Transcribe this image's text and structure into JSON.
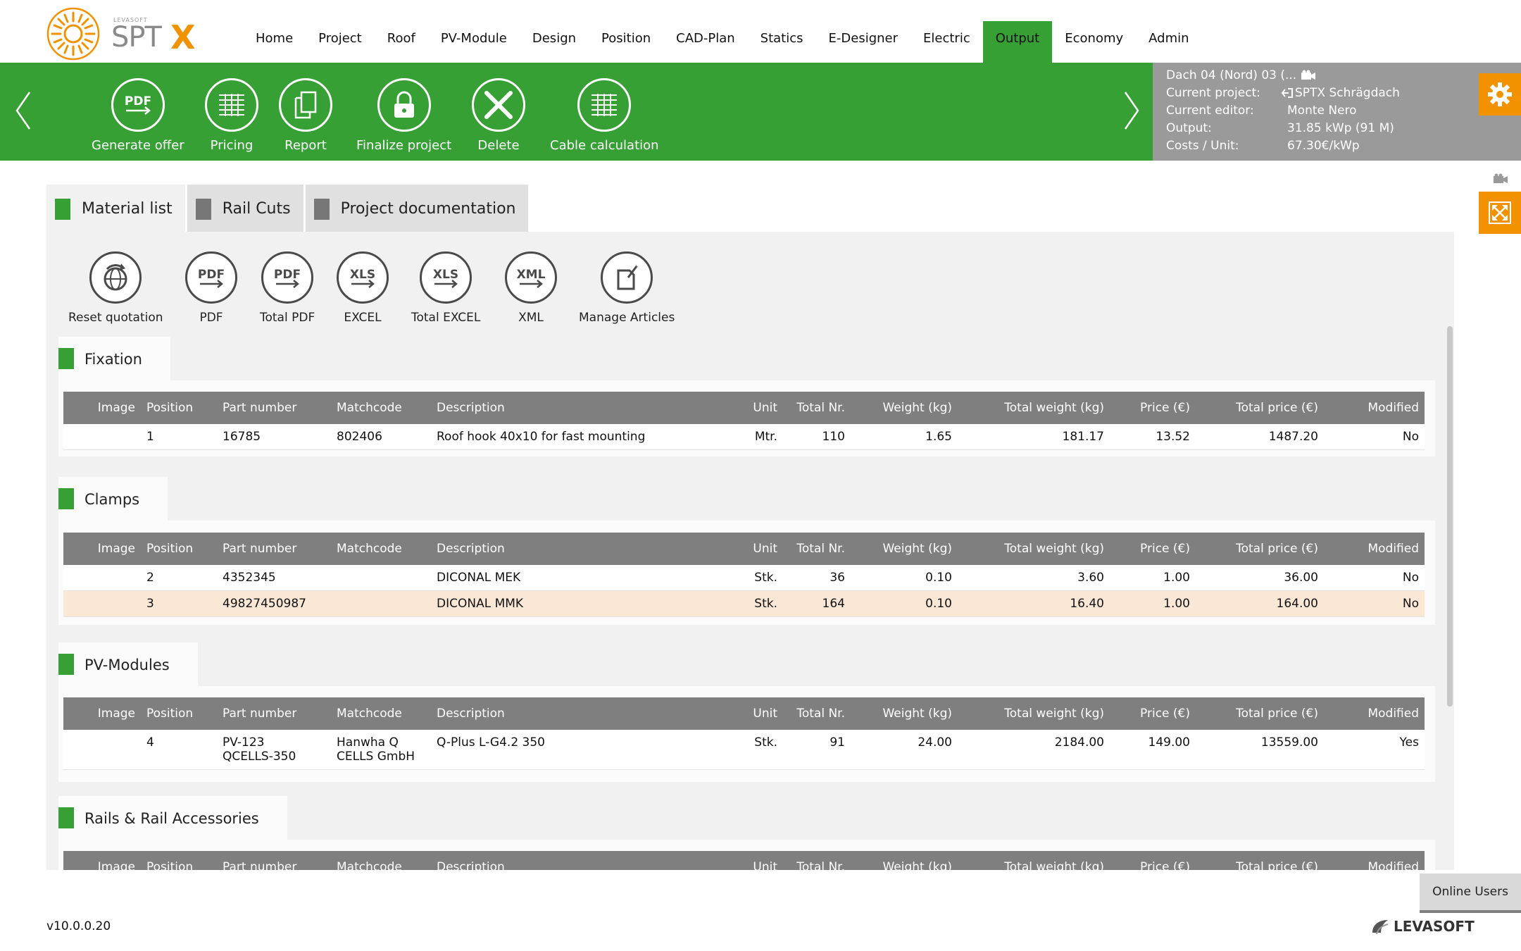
{
  "app": {
    "brand_small": "LEVASOFT",
    "brand": "SPT",
    "brand_x": "X",
    "version": "v10.0.0.20",
    "vendor": "LEVASOFT"
  },
  "nav": [
    {
      "label": "Home"
    },
    {
      "label": "Project"
    },
    {
      "label": "Roof"
    },
    {
      "label": "PV-Module"
    },
    {
      "label": "Design"
    },
    {
      "label": "Position"
    },
    {
      "label": "CAD-Plan"
    },
    {
      "label": "Statics"
    },
    {
      "label": "E-Designer"
    },
    {
      "label": "Electric"
    },
    {
      "label": "Output",
      "active": true
    },
    {
      "label": "Economy"
    },
    {
      "label": "Admin"
    }
  ],
  "toolbar": {
    "generate_offer": "Generate offer",
    "pricing": "Pricing",
    "report": "Report",
    "finalize_project": "Finalize project",
    "delete": "Delete",
    "cable_calculation": "Cable calculation"
  },
  "info": {
    "roof": "Dach 04 (Nord) 03 (...",
    "current_project_label": "Current project:",
    "current_project_value": "SPTX Schrägdach",
    "current_editor_label": "Current editor:",
    "current_editor_value": "Monte Nero",
    "output_label": "Output:",
    "output_value": "31.85 kWp (91 M)",
    "costs_label": "Costs / Unit:",
    "costs_value": "67.30€/kWp"
  },
  "tabs": [
    {
      "label": "Material list",
      "active": true
    },
    {
      "label": "Rail Cuts"
    },
    {
      "label": "Project documentation"
    }
  ],
  "actions": {
    "reset_quotation": "Reset quotation",
    "pdf": "PDF",
    "total_pdf": "Total PDF",
    "excel": "EXCEL",
    "total_excel": "Total EXCEL",
    "xml": "XML",
    "manage_articles": "Manage Articles",
    "pdf_icon": "PDF",
    "xls_icon": "XLS",
    "xml_icon": "XML"
  },
  "columns": [
    "Image",
    "Position",
    "Part number",
    "Matchcode",
    "Description",
    "Unit",
    "Total Nr.",
    "Weight (kg)",
    "Total weight (kg)",
    "Price (€)",
    "Total price (€)",
    "Modified"
  ],
  "sections": {
    "fixation": {
      "title": "Fixation",
      "rows": [
        {
          "image": "",
          "position": "1",
          "part_number": "16785",
          "matchcode": "802406",
          "description": "Roof hook 40x10 for fast mounting",
          "unit": "Mtr.",
          "total_nr": "110",
          "weight": "1.65",
          "total_weight": "181.17",
          "price": "13.52",
          "total_price": "1487.20",
          "modified": "No"
        }
      ]
    },
    "clamps": {
      "title": "Clamps",
      "rows": [
        {
          "image": "",
          "position": "2",
          "part_number": "4352345",
          "matchcode": "",
          "description": "DICONAL MEK",
          "unit": "Stk.",
          "total_nr": "36",
          "weight": "0.10",
          "total_weight": "3.60",
          "price": "1.00",
          "total_price": "36.00",
          "modified": "No"
        },
        {
          "image": "",
          "position": "3",
          "part_number": "49827450987",
          "matchcode": "",
          "description": "DICONAL MMK",
          "unit": "Stk.",
          "total_nr": "164",
          "weight": "0.10",
          "total_weight": "16.40",
          "price": "1.00",
          "total_price": "164.00",
          "modified": "No",
          "highlight": true
        }
      ]
    },
    "pv_modules": {
      "title": "PV-Modules",
      "rows": [
        {
          "image": "",
          "position": "4",
          "part_number_1": "PV-123",
          "part_number_2": "QCELLS-350",
          "matchcode_1": "Hanwha Q",
          "matchcode_2": "CELLS GmbH",
          "description": "Q-Plus L-G4.2 350",
          "unit": "Stk.",
          "total_nr": "91",
          "weight": "24.00",
          "total_weight": "2184.00",
          "price": "149.00",
          "total_price": "13559.00",
          "modified": "Yes"
        }
      ]
    },
    "rails": {
      "title": "Rails & Rail Accessories",
      "rows": []
    }
  },
  "online_users": "Online Users",
  "colors": {
    "green": "#36a035",
    "orange": "#f39200",
    "grey_header": "#7f7f7f",
    "highlight_row": "#fbe7d6"
  },
  "icons": [
    "sun-logo-icon",
    "chevron-left-icon",
    "chevron-right-icon",
    "pdf-icon",
    "pricing-list-icon",
    "report-copy-icon",
    "lock-icon",
    "delete-x-icon",
    "cable-list-icon",
    "camera-icon",
    "login-arrow-icon",
    "gear-icon",
    "expand-icon",
    "reset-globe-icon",
    "xls-icon",
    "xml-icon",
    "manage-articles-icon",
    "levasoft-logo-icon"
  ]
}
